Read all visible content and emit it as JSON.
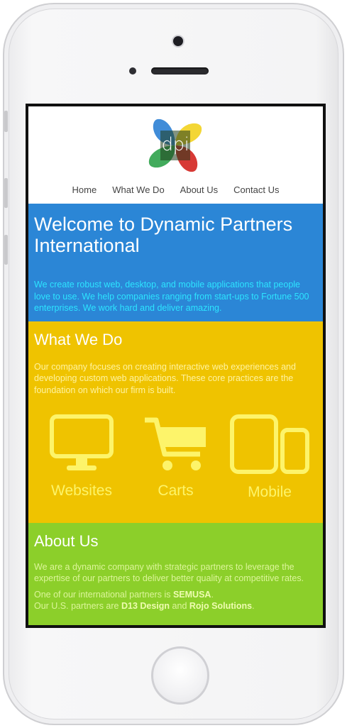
{
  "logo": {
    "text": "dpi"
  },
  "nav": {
    "items": [
      "Home",
      "What We Do",
      "About Us",
      "Contact Us"
    ]
  },
  "welcome": {
    "title": "Welcome to Dynamic Partners International",
    "text": "We create robust web, desktop, and mobile applications that people love to use. We help companies ranging from start-ups to Fortune 500 enterprises. We work hard and deliver amazing."
  },
  "what": {
    "title": "What We Do",
    "text": "Our company focuses on creating interactive web experiences and developing custom web applications. These core practices are the foundation on which our firm is built.",
    "services": [
      {
        "label": "Websites",
        "icon": "monitor-icon"
      },
      {
        "label": "Carts",
        "icon": "shopping-cart-icon"
      },
      {
        "label": "Mobile",
        "icon": "tablet-phone-icon"
      }
    ]
  },
  "about": {
    "title": "About Us",
    "text": "We are a dynamic company with strategic partners to leverage the expertise of our partners to deliver better quality at competitive rates.",
    "intl_prefix": "One of our international partners is ",
    "intl_partner": "SEMUSA",
    "intl_suffix": ".",
    "us_prefix": "Our U.S. partners are ",
    "us_partner1": "D13 Design",
    "us_and": " and ",
    "us_partner2": "Rojo Solutions",
    "us_suffix": "."
  },
  "colors": {
    "welcome_bg": "#2b86d6",
    "what_bg": "#efc300",
    "about_bg": "#8ccf2a"
  }
}
